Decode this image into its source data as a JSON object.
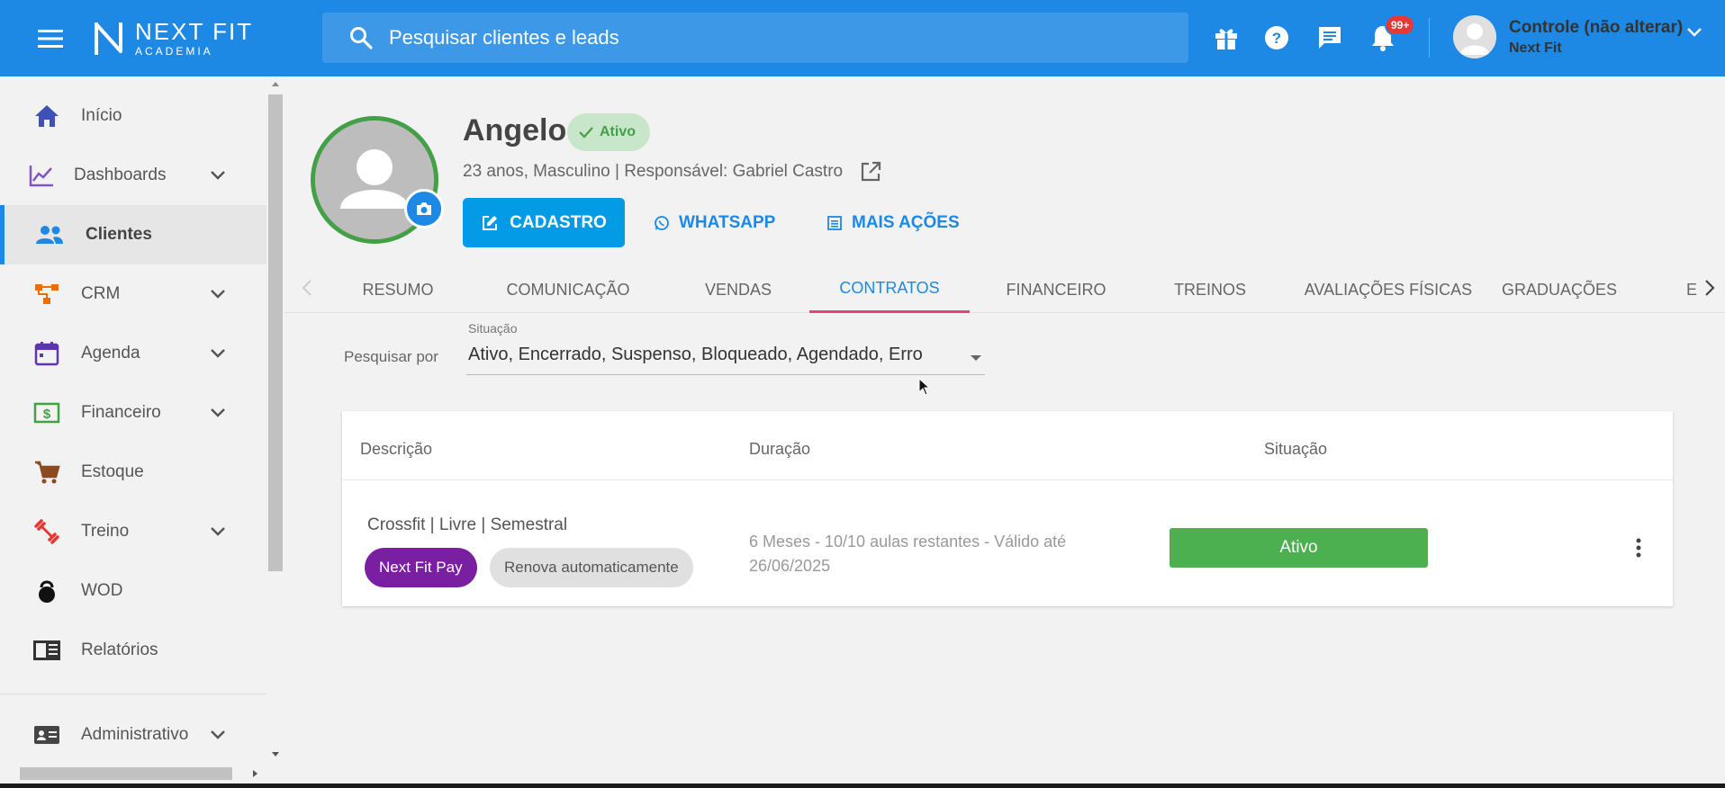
{
  "header": {
    "logo_main": "NEXT FIT",
    "logo_sub": "ACADEMIA",
    "search_placeholder": "Pesquisar clientes e leads",
    "notifications_badge": "99+",
    "user_name": "Controle (não alterar)",
    "user_org": "Next Fit"
  },
  "sidebar": {
    "items": [
      {
        "label": "Início",
        "icon": "home-icon",
        "expandable": false,
        "active": false
      },
      {
        "label": "Dashboards",
        "icon": "chart-line-icon",
        "expandable": true,
        "active": false
      },
      {
        "label": "Clientes",
        "icon": "people-icon",
        "expandable": false,
        "active": true
      },
      {
        "label": "CRM",
        "icon": "crm-icon",
        "expandable": true,
        "active": false
      },
      {
        "label": "Agenda",
        "icon": "calendar-icon",
        "expandable": true,
        "active": false
      },
      {
        "label": "Financeiro",
        "icon": "money-icon",
        "expandable": true,
        "active": false
      },
      {
        "label": "Estoque",
        "icon": "cart-icon",
        "expandable": false,
        "active": false
      },
      {
        "label": "Treino",
        "icon": "dumbbell-icon",
        "expandable": true,
        "active": false
      },
      {
        "label": "WOD",
        "icon": "kettlebell-icon",
        "expandable": false,
        "active": false
      },
      {
        "label": "Relatórios",
        "icon": "report-icon",
        "expandable": false,
        "active": false
      },
      {
        "label": "Administrativo",
        "icon": "id-card-icon",
        "expandable": true,
        "active": false
      }
    ]
  },
  "client": {
    "name": "Angelo",
    "status": "Ativo",
    "info": "23 anos, Masculino | Responsável: Gabriel Castro",
    "actions": {
      "cadastro": "CADASTRO",
      "whatsapp": "WHATSAPP",
      "mais_acoes": "MAIS AÇÕES"
    }
  },
  "tabs": [
    {
      "label": "RESUMO",
      "active": false
    },
    {
      "label": "COMUNICAÇÃO",
      "active": false
    },
    {
      "label": "VENDAS",
      "active": false
    },
    {
      "label": "CONTRATOS",
      "active": true
    },
    {
      "label": "FINANCEIRO",
      "active": false
    },
    {
      "label": "TREINOS",
      "active": false
    },
    {
      "label": "AVALIAÇÕES FÍSICAS",
      "active": false
    },
    {
      "label": "GRADUAÇÕES",
      "active": false
    },
    {
      "label": "E",
      "active": false
    }
  ],
  "filter": {
    "label": "Pesquisar por",
    "caption": "Situação",
    "value": "Ativo, Encerrado, Suspenso, Bloqueado, Agendado, Erro"
  },
  "contracts_table": {
    "headers": [
      "Descrição",
      "Duração",
      "Situação"
    ],
    "rows": [
      {
        "description": "Crossfit | Livre | Semestral",
        "tags": [
          "Next Fit Pay",
          "Renova automaticamente"
        ],
        "duration": "6 Meses - 10/10 aulas restantes - Válido até 26/06/2025",
        "status": "Ativo"
      }
    ]
  },
  "colors": {
    "primary": "#1e88e5",
    "active_green": "#4caf50",
    "tab_indicator": "#ec407a",
    "pay_chip": "#7b1fa2"
  }
}
